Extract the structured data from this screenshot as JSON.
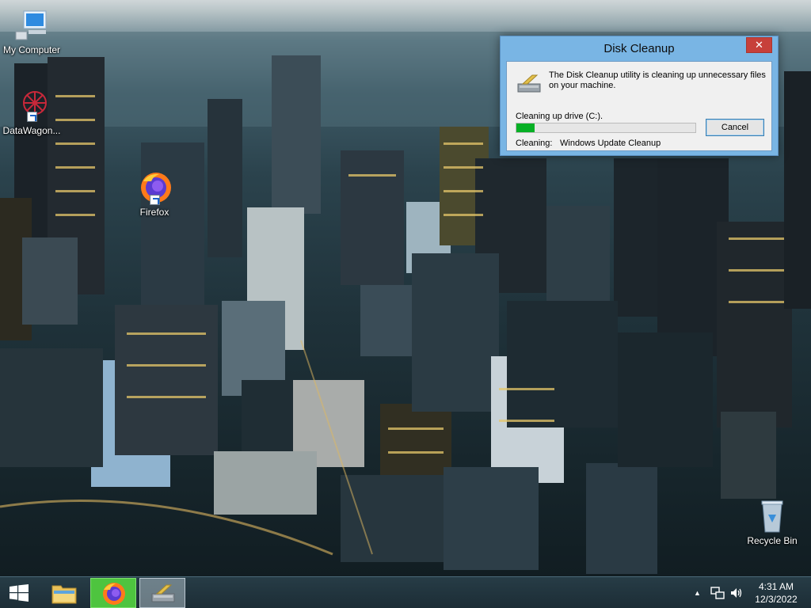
{
  "desktop": {
    "icons": [
      {
        "label": "My Computer",
        "icon": "computer-icon"
      },
      {
        "label": "DataWagon...",
        "icon": "datawagon-icon"
      },
      {
        "label": "Firefox",
        "icon": "firefox-icon"
      },
      {
        "label": "Recycle Bin",
        "icon": "recycle-bin-icon"
      }
    ]
  },
  "dialog": {
    "title": "Disk Cleanup",
    "close_label": "✕",
    "intro": "The Disk Cleanup utility is cleaning up unnecessary files on your machine.",
    "drive_label": "Cleaning up drive  (C:).",
    "progress": 0.1,
    "cancel_label": "Cancel",
    "cleaning_label": "Cleaning:",
    "cleaning_value": "Windows Update Cleanup"
  },
  "taskbar": {
    "apps": [
      {
        "icon": "file-explorer-icon"
      },
      {
        "icon": "firefox-icon",
        "active": true
      },
      {
        "icon": "disk-cleanup-icon",
        "open": true
      }
    ],
    "tray": {
      "chevron": "▲",
      "icons": [
        "network-icon",
        "volume-icon"
      ]
    },
    "clock": {
      "time": "4:31 AM",
      "date": "12/3/2022"
    }
  },
  "colors": {
    "accent_titlebar": "#79b5e4",
    "close_button": "#c7403a",
    "progress_fill": "#06b025",
    "firefox_task_highlight": "#4ec43f"
  }
}
